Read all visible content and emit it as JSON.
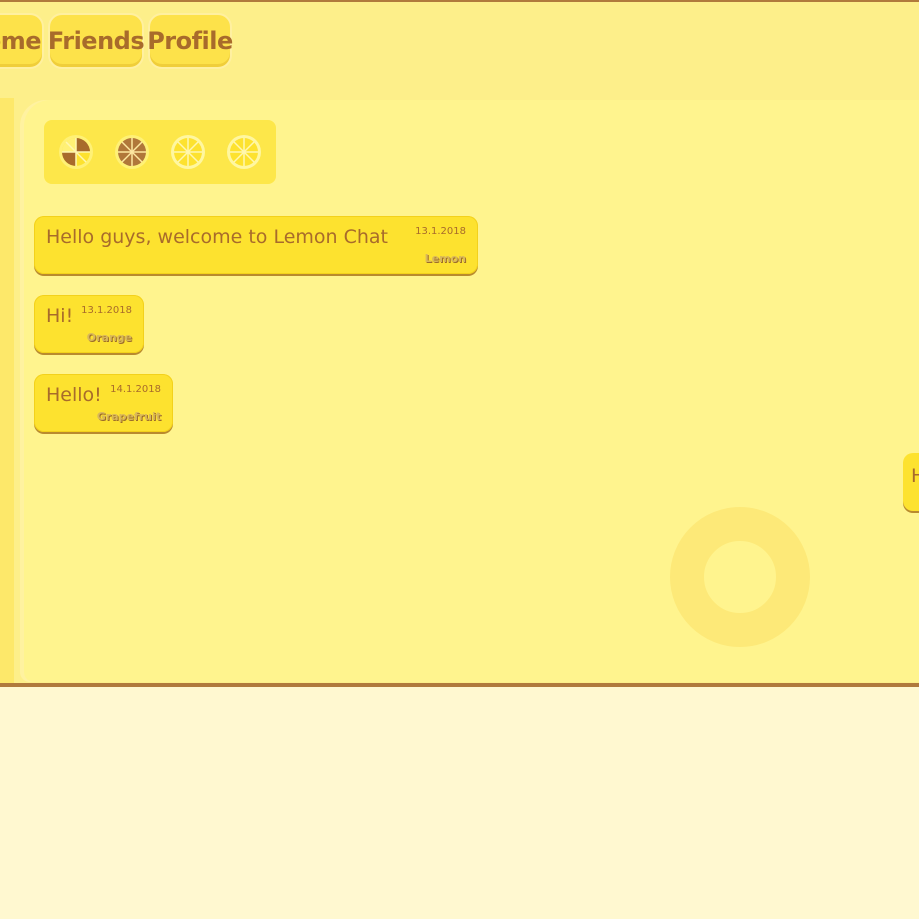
{
  "nav": {
    "home_label": "Home",
    "friends_label": "Friends",
    "profile_label": "Profile"
  },
  "status_bar": {
    "icons": [
      "lemon-partial-icon",
      "orange-slice-icon",
      "lemon-slice-icon",
      "lemon-slice-icon"
    ]
  },
  "messages": [
    {
      "text": "Hello guys, welcome to Lemon Chat",
      "date": "13.1.2018",
      "author": "Lemon"
    },
    {
      "text": "Hi!",
      "date": "13.1.2018",
      "author": "Orange"
    },
    {
      "text": "Hello!",
      "date": "14.1.2018",
      "author": "Grapefruit"
    }
  ],
  "right_message": {
    "text": "H"
  },
  "colors": {
    "accent": "#fde22f",
    "text": "#a86b2b",
    "background": "#fdef8a",
    "panel": "#fff48e",
    "border": "#b07a3c"
  }
}
